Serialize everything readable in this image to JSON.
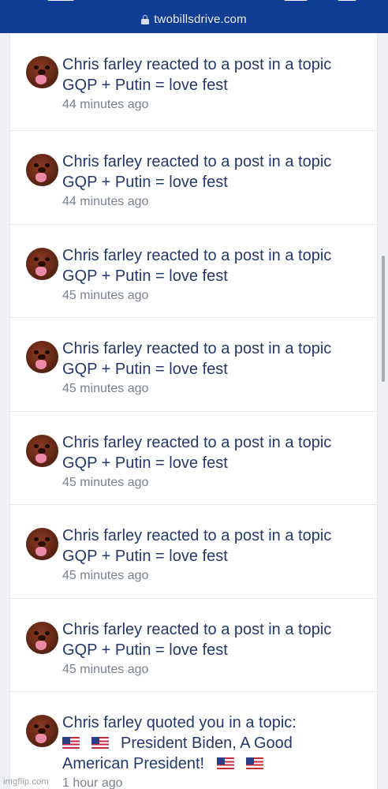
{
  "browser": {
    "url": "twobillsdrive.com",
    "theme_color": "#0f3c94"
  },
  "notifications": [
    {
      "line1": "Chris farley reacted to a post in a topic",
      "line2": "GQP + Putin = love fest",
      "time": "44 minutes ago"
    },
    {
      "line1": "Chris farley reacted to a post in a topic",
      "line2": "GQP + Putin = love fest",
      "time": "44 minutes ago"
    },
    {
      "line1": "Chris farley reacted to a post in a topic",
      "line2": "GQP + Putin = love fest",
      "time": "45 minutes ago"
    },
    {
      "line1": "Chris farley reacted to a post in a topic",
      "line2": "GQP + Putin = love fest",
      "time": "45 minutes ago"
    },
    {
      "line1": "Chris farley reacted to a post in a topic",
      "line2": "GQP + Putin = love fest",
      "time": "45 minutes ago"
    },
    {
      "line1": "Chris farley reacted to a post in a topic",
      "line2": "GQP + Putin = love fest",
      "time": "45 minutes ago"
    },
    {
      "line1": "Chris farley reacted to a post in a topic",
      "line2": "GQP + Putin = love fest",
      "time": "45 minutes ago"
    }
  ],
  "quote_notification": {
    "line1": "Chris farley quoted you in a topic:",
    "line2": "President Biden, A Good",
    "line3": "American President!",
    "time": "1 hour ago",
    "flag_icon": "us-flag-icon"
  },
  "colors": {
    "link_text": "#24386a",
    "time_text": "#7a828e"
  },
  "watermark": "imgflip.com"
}
